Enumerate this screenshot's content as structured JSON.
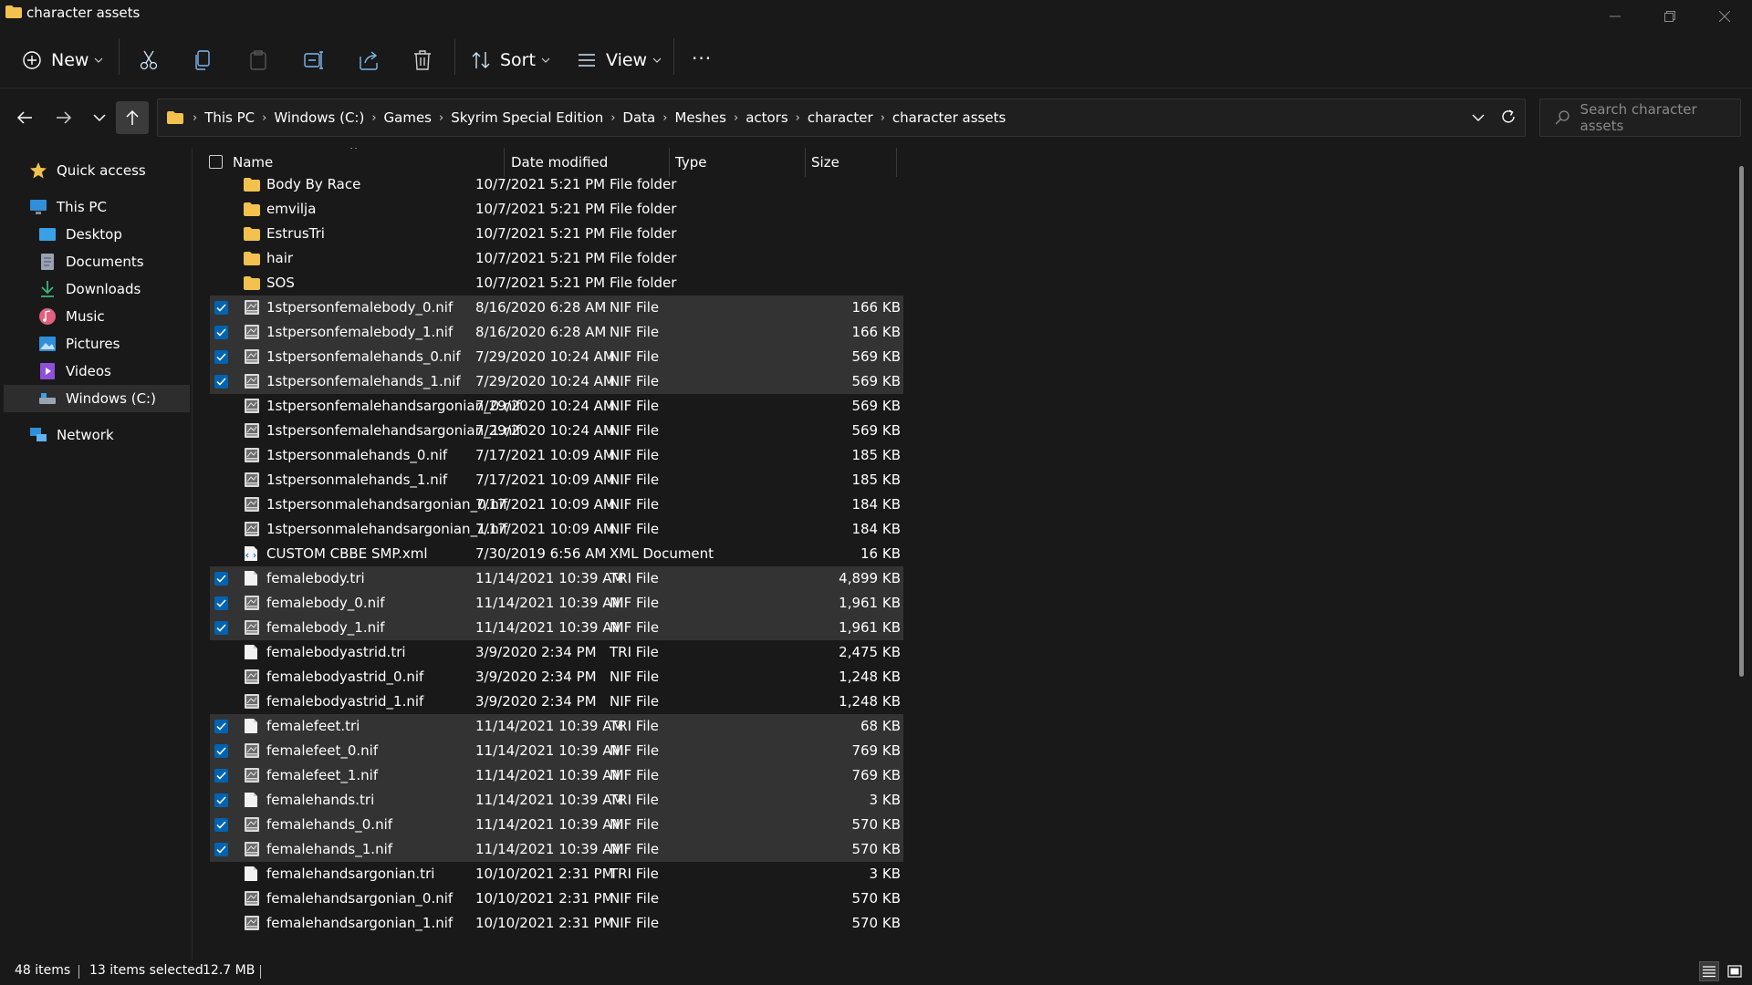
{
  "window": {
    "title": "character assets"
  },
  "commandbar": {
    "new_label": "New",
    "sort_label": "Sort",
    "view_label": "View",
    "more_label": "···"
  },
  "address": {
    "crumbs": [
      "This PC",
      "Windows (C:)",
      "Games",
      "Skyrim Special Edition",
      "Data",
      "Meshes",
      "actors",
      "character",
      "character assets"
    ]
  },
  "search": {
    "placeholder": "Search character assets"
  },
  "sidebar": {
    "items": [
      {
        "label": "Quick access",
        "icon": "star-icon"
      },
      {
        "label": "This PC",
        "icon": "computer-icon"
      },
      {
        "label": "Desktop",
        "icon": "desktop-icon"
      },
      {
        "label": "Documents",
        "icon": "documents-icon"
      },
      {
        "label": "Downloads",
        "icon": "downloads-icon"
      },
      {
        "label": "Music",
        "icon": "music-icon"
      },
      {
        "label": "Pictures",
        "icon": "pictures-icon"
      },
      {
        "label": "Videos",
        "icon": "videos-icon"
      },
      {
        "label": "Windows (C:)",
        "icon": "drive-icon"
      },
      {
        "label": "Network",
        "icon": "network-icon"
      }
    ]
  },
  "columns": {
    "name": "Name",
    "date": "Date modified",
    "type": "Type",
    "size": "Size"
  },
  "files": [
    {
      "name": "Body By Race",
      "date": "10/7/2021 5:21 PM",
      "type": "File folder",
      "size": "",
      "kind": "folder",
      "selected": false
    },
    {
      "name": "emvilja",
      "date": "10/7/2021 5:21 PM",
      "type": "File folder",
      "size": "",
      "kind": "folder",
      "selected": false
    },
    {
      "name": "EstrusTri",
      "date": "10/7/2021 5:21 PM",
      "type": "File folder",
      "size": "",
      "kind": "folder",
      "selected": false
    },
    {
      "name": "hair",
      "date": "10/7/2021 5:21 PM",
      "type": "File folder",
      "size": "",
      "kind": "folder",
      "selected": false
    },
    {
      "name": "SOS",
      "date": "10/7/2021 5:21 PM",
      "type": "File folder",
      "size": "",
      "kind": "folder",
      "selected": false
    },
    {
      "name": "1stpersonfemalebody_0.nif",
      "date": "8/16/2020 6:28 AM",
      "type": "NIF File",
      "size": "166 KB",
      "kind": "nif",
      "selected": true
    },
    {
      "name": "1stpersonfemalebody_1.nif",
      "date": "8/16/2020 6:28 AM",
      "type": "NIF File",
      "size": "166 KB",
      "kind": "nif",
      "selected": true
    },
    {
      "name": "1stpersonfemalehands_0.nif",
      "date": "7/29/2020 10:24 AM",
      "type": "NIF File",
      "size": "569 KB",
      "kind": "nif",
      "selected": true
    },
    {
      "name": "1stpersonfemalehands_1.nif",
      "date": "7/29/2020 10:24 AM",
      "type": "NIF File",
      "size": "569 KB",
      "kind": "nif",
      "selected": true
    },
    {
      "name": "1stpersonfemalehandsargonian_0.nif",
      "date": "7/29/2020 10:24 AM",
      "type": "NIF File",
      "size": "569 KB",
      "kind": "nif",
      "selected": false
    },
    {
      "name": "1stpersonfemalehandsargonian_1.nif",
      "date": "7/29/2020 10:24 AM",
      "type": "NIF File",
      "size": "569 KB",
      "kind": "nif",
      "selected": false
    },
    {
      "name": "1stpersonmalehands_0.nif",
      "date": "7/17/2021 10:09 AM",
      "type": "NIF File",
      "size": "185 KB",
      "kind": "nif",
      "selected": false
    },
    {
      "name": "1stpersonmalehands_1.nif",
      "date": "7/17/2021 10:09 AM",
      "type": "NIF File",
      "size": "185 KB",
      "kind": "nif",
      "selected": false
    },
    {
      "name": "1stpersonmalehandsargonian_0.nif",
      "date": "7/17/2021 10:09 AM",
      "type": "NIF File",
      "size": "184 KB",
      "kind": "nif",
      "selected": false
    },
    {
      "name": "1stpersonmalehandsargonian_1.nif",
      "date": "7/17/2021 10:09 AM",
      "type": "NIF File",
      "size": "184 KB",
      "kind": "nif",
      "selected": false
    },
    {
      "name": "CUSTOM CBBE SMP.xml",
      "date": "7/30/2019 6:56 AM",
      "type": "XML Document",
      "size": "16 KB",
      "kind": "xml",
      "selected": false
    },
    {
      "name": "femalebody.tri",
      "date": "11/14/2021 10:39 AM",
      "type": "TRI File",
      "size": "4,899 KB",
      "kind": "tri",
      "selected": true
    },
    {
      "name": "femalebody_0.nif",
      "date": "11/14/2021 10:39 AM",
      "type": "NIF File",
      "size": "1,961 KB",
      "kind": "nif",
      "selected": true
    },
    {
      "name": "femalebody_1.nif",
      "date": "11/14/2021 10:39 AM",
      "type": "NIF File",
      "size": "1,961 KB",
      "kind": "nif",
      "selected": true
    },
    {
      "name": "femalebodyastrid.tri",
      "date": "3/9/2020 2:34 PM",
      "type": "TRI File",
      "size": "2,475 KB",
      "kind": "tri",
      "selected": false
    },
    {
      "name": "femalebodyastrid_0.nif",
      "date": "3/9/2020 2:34 PM",
      "type": "NIF File",
      "size": "1,248 KB",
      "kind": "nif",
      "selected": false
    },
    {
      "name": "femalebodyastrid_1.nif",
      "date": "3/9/2020 2:34 PM",
      "type": "NIF File",
      "size": "1,248 KB",
      "kind": "nif",
      "selected": false
    },
    {
      "name": "femalefeet.tri",
      "date": "11/14/2021 10:39 AM",
      "type": "TRI File",
      "size": "68 KB",
      "kind": "tri",
      "selected": true
    },
    {
      "name": "femalefeet_0.nif",
      "date": "11/14/2021 10:39 AM",
      "type": "NIF File",
      "size": "769 KB",
      "kind": "nif",
      "selected": true
    },
    {
      "name": "femalefeet_1.nif",
      "date": "11/14/2021 10:39 AM",
      "type": "NIF File",
      "size": "769 KB",
      "kind": "nif",
      "selected": true
    },
    {
      "name": "femalehands.tri",
      "date": "11/14/2021 10:39 AM",
      "type": "TRI File",
      "size": "3 KB",
      "kind": "tri",
      "selected": true
    },
    {
      "name": "femalehands_0.nif",
      "date": "11/14/2021 10:39 AM",
      "type": "NIF File",
      "size": "570 KB",
      "kind": "nif",
      "selected": true
    },
    {
      "name": "femalehands_1.nif",
      "date": "11/14/2021 10:39 AM",
      "type": "NIF File",
      "size": "570 KB",
      "kind": "nif",
      "selected": true
    },
    {
      "name": "femalehandsargonian.tri",
      "date": "10/10/2021 2:31 PM",
      "type": "TRI File",
      "size": "3 KB",
      "kind": "tri",
      "selected": false
    },
    {
      "name": "femalehandsargonian_0.nif",
      "date": "10/10/2021 2:31 PM",
      "type": "NIF File",
      "size": "570 KB",
      "kind": "nif",
      "selected": false
    },
    {
      "name": "femalehandsargonian_1.nif",
      "date": "10/10/2021 2:31 PM",
      "type": "NIF File",
      "size": "570 KB",
      "kind": "nif",
      "selected": false
    }
  ],
  "status": {
    "item_count": "48 items",
    "selected_count": "13 items selected",
    "selected_size": "12.7 MB"
  },
  "colors": {
    "background": "#191919",
    "selected_row": "#333333",
    "checkbox": "#0063b1",
    "folder": "#f2c14e"
  }
}
